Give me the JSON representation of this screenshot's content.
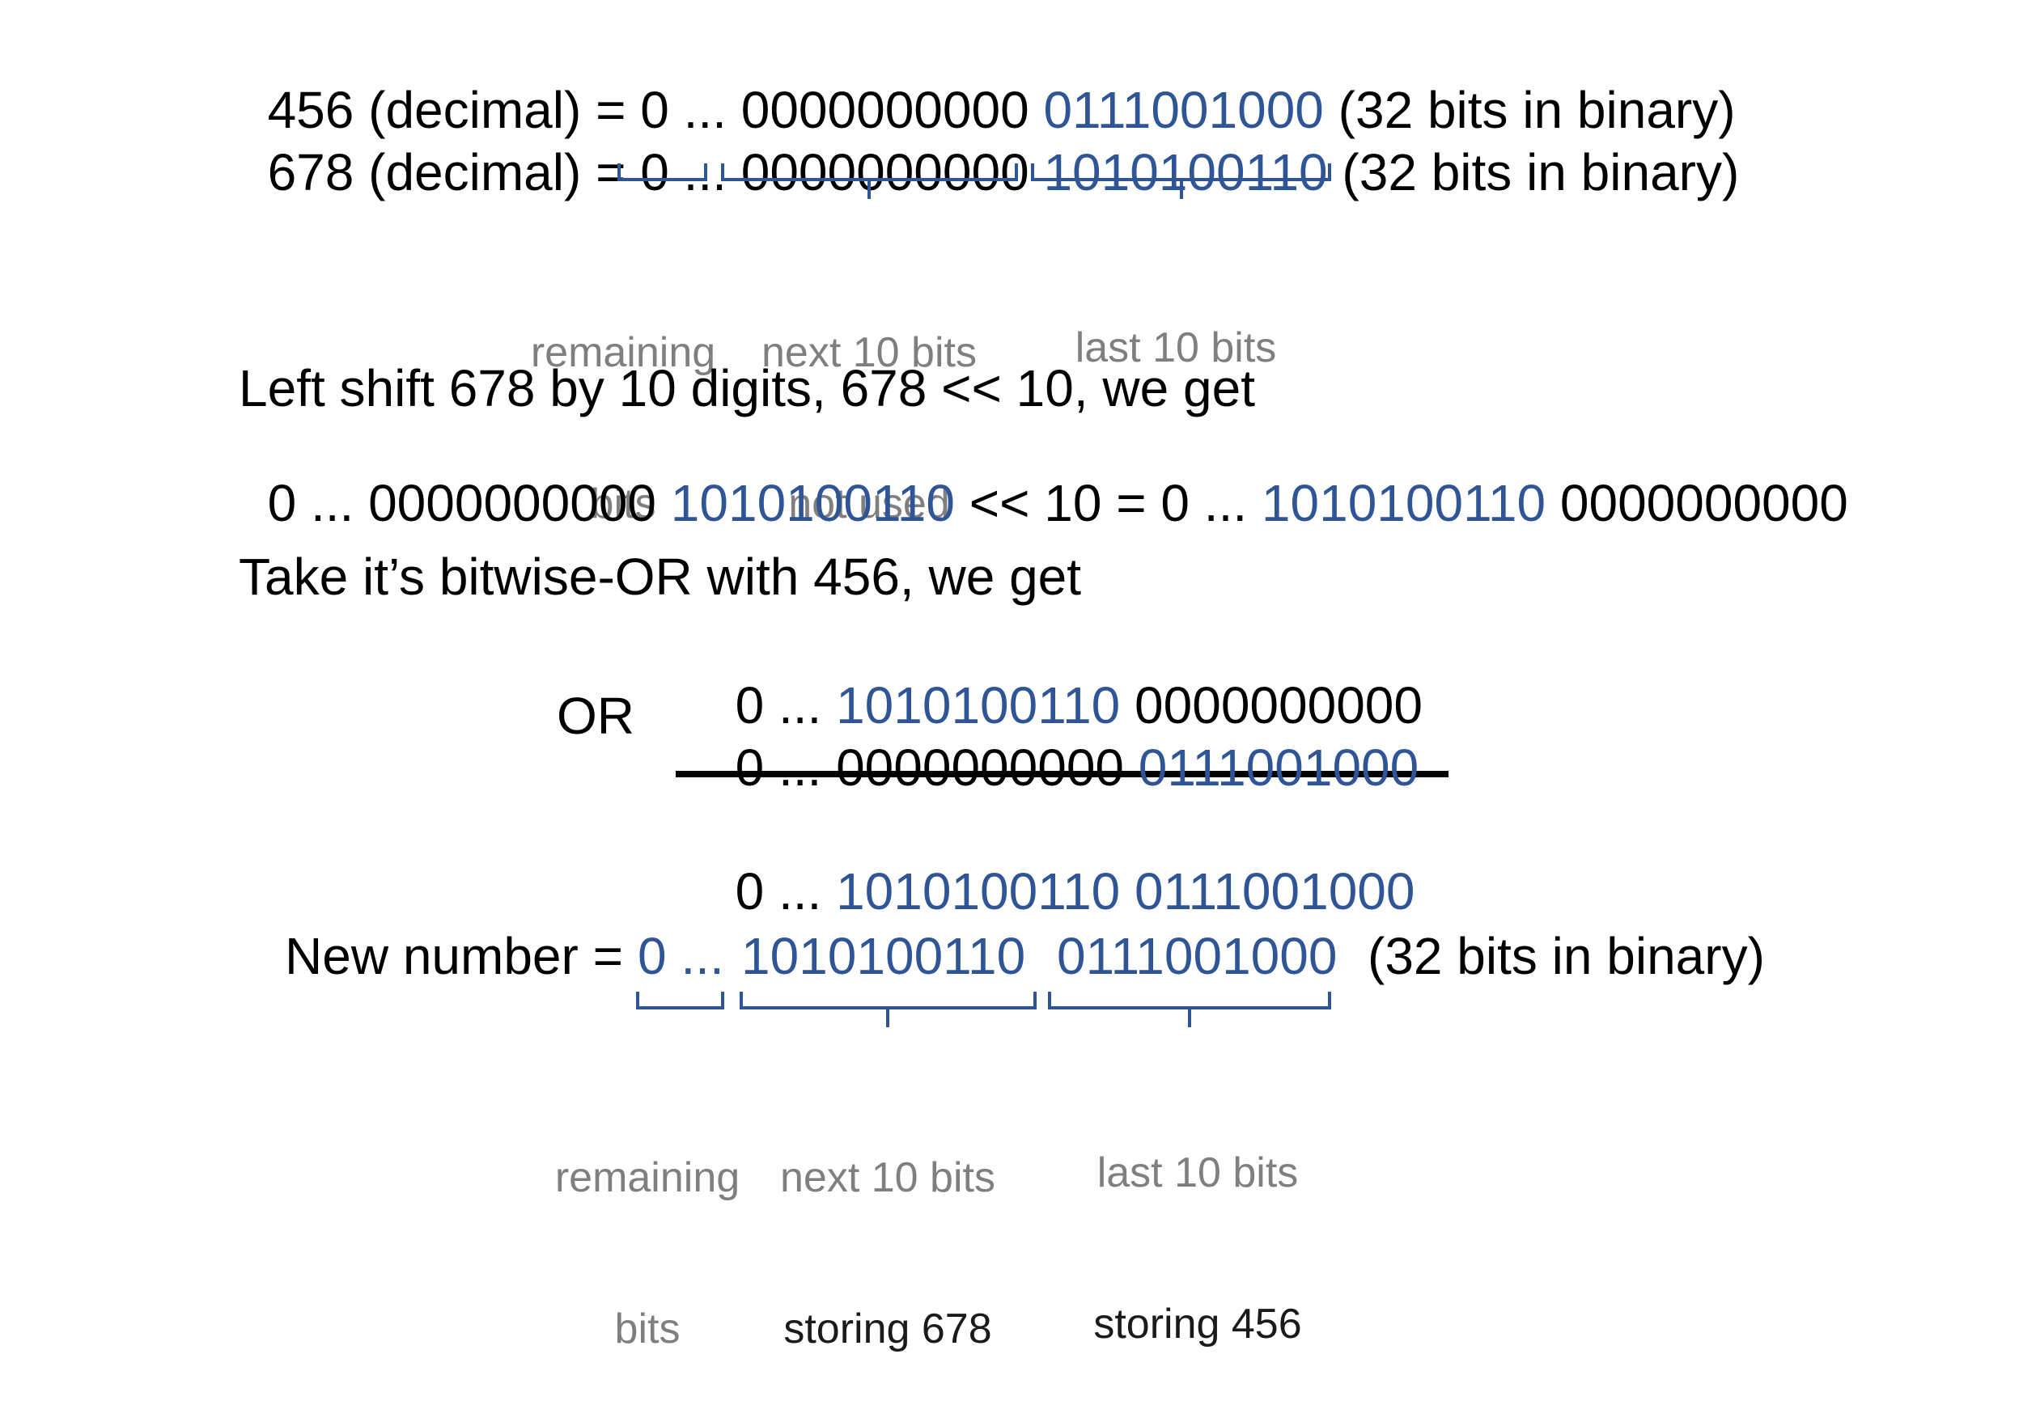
{
  "colors": {
    "accent_blue": "#2f5597",
    "label_gray": "#7f7f7f",
    "text": "#000000"
  },
  "top": {
    "line1": {
      "prefix": "456 (decimal) = 0 ... 0000000000 ",
      "bits": "0111001000",
      "suffix": " (32 bits in binary)"
    },
    "line2": {
      "prefix": "678 (decimal) = 0 ... 0000000000 ",
      "bits": "1010100110",
      "suffix": " (32 bits in binary)"
    },
    "labels": {
      "remaining": [
        "remaining",
        "bits"
      ],
      "next": [
        "next 10 bits",
        "not used"
      ],
      "last": "last 10 bits"
    }
  },
  "shift": {
    "heading": "Left shift 678 by 10 digits, 678 << 10, we get",
    "expr_prefix": "0 ... 0000000000 ",
    "expr_bits1": "1010100110",
    "expr_mid": " << 10 = 0 ... ",
    "expr_bits2": "1010100110",
    "expr_suffix": " 0000000000"
  },
  "or_section": {
    "heading": "Take it’s bitwise-OR with 456, we get",
    "row1": {
      "prefix": "0 ... ",
      "bits": "1010100110",
      "suffix": " 0000000000"
    },
    "or_label": "OR",
    "row2": {
      "prefix": "0 ... 0000000000 ",
      "bits": "0111001000"
    },
    "result": {
      "prefix": "0 ... ",
      "bits1": "1010100110",
      "sep": " ",
      "bits2": "0111001000"
    }
  },
  "new_number": {
    "prefix": "New number = ",
    "zero": "0 ...",
    "bits1": "1010100110",
    "bits2": "0111001000",
    "suffix": "(32 bits in binary)",
    "labels": {
      "remaining": [
        "remaining",
        "bits"
      ],
      "next": [
        "next 10 bits",
        "storing 678"
      ],
      "last": [
        "last 10 bits",
        "storing 456"
      ]
    }
  }
}
